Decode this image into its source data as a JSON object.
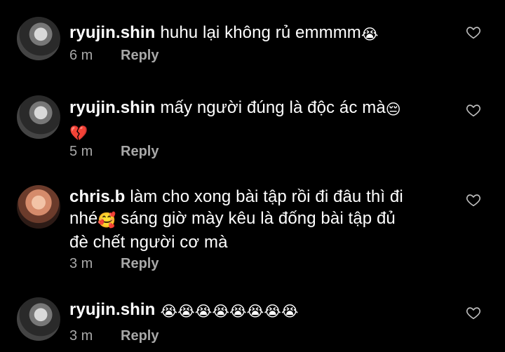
{
  "comments": [
    {
      "username": "ryujin.shin",
      "text": "huhu lại không rủ emmmm",
      "emojis": "😭",
      "time": "6 m",
      "reply": "Reply"
    },
    {
      "username": "ryujin.shin",
      "text": "mấy người đúng là độc ác mà",
      "emojis": "😔",
      "emojis_line2": "💔",
      "time": "5 m",
      "reply": "Reply"
    },
    {
      "username": "chris.b",
      "text": "làm cho xong bài tập rồi đi đâu thì đi",
      "text_line2_a": "nhé",
      "emoji_mid": "🥰",
      "text_line2_b": " sáng giờ mày kêu là đống bài tập đủ",
      "text_line3": "đè chết người cơ mà",
      "time": "3 m",
      "reply": "Reply"
    },
    {
      "username": "ryujin.shin",
      "text": "",
      "emojis": "😭😭😭😭😭😭😭😭",
      "time": "3 m",
      "reply": "Reply"
    }
  ],
  "icons": {
    "like": "heart-outline-icon"
  },
  "colors": {
    "background": "#000000",
    "text": "#ffffff",
    "meta": "#a8a8a8"
  }
}
